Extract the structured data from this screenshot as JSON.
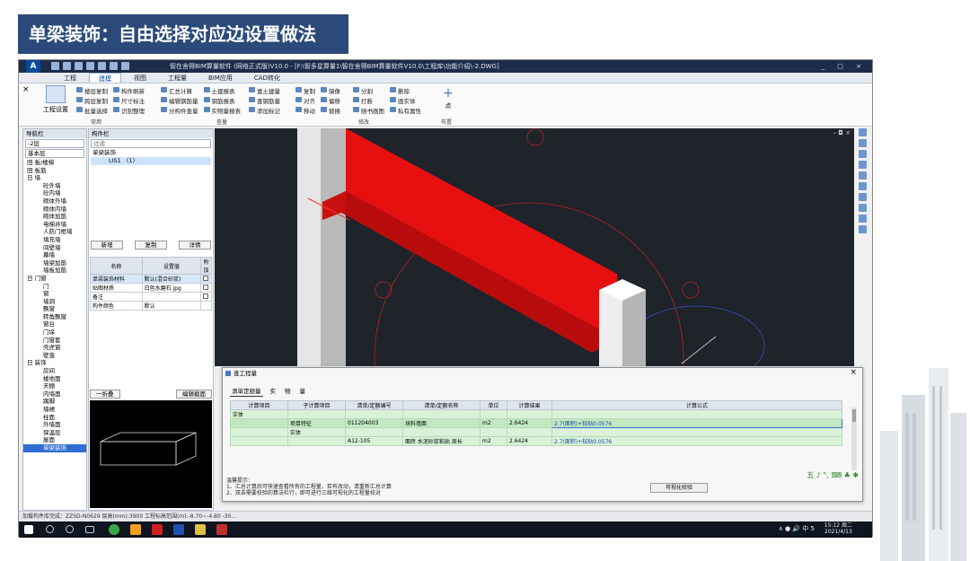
{
  "slide": {
    "title": "单梁装饰：自由选择对应边设置做法"
  },
  "app": {
    "logo": "A",
    "window_title": "智在舍得BIM算量软件 (网络正式版)V10.0 - [F:\\智多星算量1\\智在舍得BIM算量软件V10.0\\工程库\\功能介绍\\-2.DWG]",
    "window_controls": "_ □ ×",
    "menu_tabs": [
      "工程",
      "建模",
      "视图",
      "工程量",
      "BIM应用",
      "CAD转化"
    ],
    "active_tab": "建模"
  },
  "ribbon": {
    "big_button": "工程设置",
    "groups": [
      {
        "label": "常用",
        "items": [
          "楼层复制",
          "构件刷新",
          "跨层复制",
          "尺寸标注",
          "批量选择",
          "识别整理"
        ]
      },
      {
        "label": "",
        "items": [
          "汇总计算",
          "土建报表",
          "编辑钢筋量",
          "钢筋报表",
          "分构件查量",
          "实物量报表"
        ]
      },
      {
        "label": "查量",
        "items": [
          "富土建量",
          "查钢筋量",
          "添加标记"
        ]
      },
      {
        "label": "",
        "items": [
          "复制",
          "镜像",
          "对齐",
          "偏移",
          "移动",
          "替换"
        ]
      },
      {
        "label": "修改",
        "items": [
          "分割",
          "删除",
          "打断",
          "画实体",
          "随书画图",
          "私有属性"
        ]
      },
      {
        "label": "布置",
        "items": [
          "点"
        ]
      }
    ]
  },
  "left_panel": {
    "header": "导航栏",
    "floor_select": "-2层",
    "section": "基本层",
    "items": [
      {
        "label": "田 板/楼梯",
        "level": 0
      },
      {
        "label": "田 板筋",
        "level": 0
      },
      {
        "label": "日 墙",
        "level": 0
      },
      {
        "label": "砼外墙",
        "level": 1
      },
      {
        "label": "砼内墙",
        "level": 1
      },
      {
        "label": "砌体外墙",
        "level": 1
      },
      {
        "label": "砌体内墙",
        "level": 1
      },
      {
        "label": "砌体加筋",
        "level": 1
      },
      {
        "label": "电梯井墙",
        "level": 1
      },
      {
        "label": "人防门框墙",
        "level": 1
      },
      {
        "label": "填充墙",
        "level": 1
      },
      {
        "label": "间壁墙",
        "level": 1
      },
      {
        "label": "幕墙",
        "level": 1
      },
      {
        "label": "墙梁加筋",
        "level": 1
      },
      {
        "label": "墙板加筋",
        "level": 1
      },
      {
        "label": "日 门窗",
        "level": 0
      },
      {
        "label": "门",
        "level": 1
      },
      {
        "label": "窗",
        "level": 1
      },
      {
        "label": "墙洞",
        "level": 1
      },
      {
        "label": "飘窗",
        "level": 1
      },
      {
        "label": "转角飘窗",
        "level": 1
      },
      {
        "label": "窗台",
        "level": 1
      },
      {
        "label": "门垛",
        "level": 1
      },
      {
        "label": "门窗套",
        "level": 1
      },
      {
        "label": "壳虎窗",
        "level": 1
      },
      {
        "label": "壁龛",
        "level": 1
      },
      {
        "label": "日 装饰",
        "level": 0
      },
      {
        "label": "房间",
        "level": 1
      },
      {
        "label": "楼地面",
        "level": 1
      },
      {
        "label": "天棚",
        "level": 1
      },
      {
        "label": "内墙面",
        "level": 1
      },
      {
        "label": "踢脚",
        "level": 1
      },
      {
        "label": "墙裙",
        "level": 1
      },
      {
        "label": "柱面",
        "level": 1
      },
      {
        "label": "外墙面",
        "level": 1
      },
      {
        "label": "保温层",
        "level": 1
      },
      {
        "label": "屋面",
        "level": 1
      },
      {
        "label": "单梁装饰",
        "level": 1,
        "selected": true
      }
    ]
  },
  "mid_panel": {
    "header": "构件栏",
    "filter_placeholder": "过滤",
    "tree_root": "单梁装饰",
    "tree_item": "LIS1  〈1〉",
    "buttons": [
      "新增",
      "复制",
      "详情"
    ],
    "prop_headers": [
      "名称",
      "设置值",
      "附加"
    ],
    "props": [
      {
        "name": "单梁装饰材料",
        "value": "默认(混合砂浆)"
      },
      {
        "name": "贴图材质",
        "value": "白色水磨石.jpg"
      },
      {
        "name": "备注",
        "value": ""
      },
      {
        "name": "构件颜色",
        "value": "默认"
      }
    ],
    "preview_left": "一折叠",
    "preview_right": "编辑截面"
  },
  "viewport": {
    "controls": "– ◘ ×"
  },
  "dialog": {
    "title": "查工程量",
    "close": "×",
    "tabs": [
      "清单定额量",
      "实",
      "物",
      "量"
    ],
    "headers": [
      "计算项目",
      "子计算项目",
      "清单/定额编号",
      "清单/定额名称",
      "单位",
      "计算结果",
      "计算公式"
    ],
    "rows": [
      [
        "实体",
        "",
        "",
        "",
        "",
        "",
        ""
      ],
      [
        "",
        "项目特征",
        "011204003",
        "块料墙面",
        "m2",
        "2.6424",
        "2.7(面积)+粘贴0.0576"
      ],
      [
        "",
        "实体",
        "",
        "",
        "",
        "",
        ""
      ],
      [
        "",
        "",
        "A12-105",
        "面砖 水泥砂浆粘贴 周长",
        "m2",
        "2.6424",
        "2.7(面积)+粘贴0.0576"
      ]
    ],
    "tips_title": "温馨提示：",
    "tips": [
      "1、汇总计算后可快速查看所有的工程量，若有改动，请重新汇总计算",
      "2、双击需要校验的算法栏行，即可进行三维可视化的工程量校对"
    ],
    "viz_button": "可视化校验",
    "ime_text": "五 ♪ °, ⌨ ♣ ✱"
  },
  "statusbar": {
    "text": "加载构件库完成：ZZSD-N0629  层高(mm):3900 工程标高范围(m):-8.70~-4.80  -30..."
  },
  "taskbar": {
    "tray_text": "∧ ● 🔊 中 5",
    "time": "15:12 周二",
    "date": "2021/4/13"
  },
  "colors": {
    "title_bar": "#2b4a7a",
    "beam_red": "#ee1111",
    "viewport_bg": "#1f232a",
    "table_green": "#d9f2d9"
  }
}
